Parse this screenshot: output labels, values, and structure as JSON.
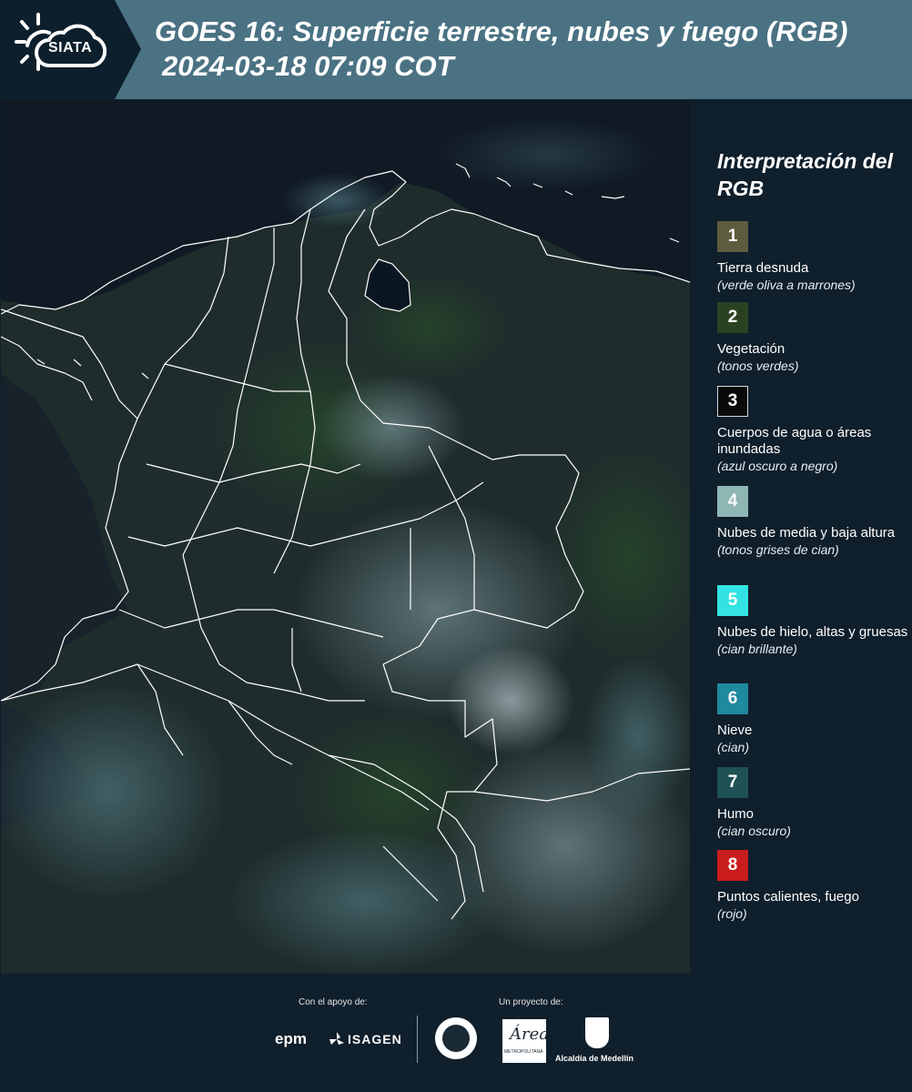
{
  "header": {
    "logo_text": "SIATA",
    "title_line1": "GOES 16: Superficie terrestre, nubes y fuego (RGB)",
    "title_line2": "2024-03-18 07:09 COT"
  },
  "legend": {
    "title": "Interpretación del RGB",
    "items": [
      {
        "num": "1",
        "label": "Tierra desnuda",
        "desc": "(verde oliva a marrones)",
        "color": "#5c5c3f",
        "text_color": "#ffffff"
      },
      {
        "num": "2",
        "label": "Vegetación",
        "desc": "(tonos verdes)",
        "color": "#2b4222",
        "text_color": "#ffffff"
      },
      {
        "num": "3",
        "label": "Cuerpos de agua o áreas inundadas",
        "desc": "(azul oscuro a negro)",
        "color": "#0a0a0a",
        "text_color": "#ffffff"
      },
      {
        "num": "4",
        "label": "Nubes de media y baja altura",
        "desc": "(tonos grises de cian)",
        "color": "#8fb5b5",
        "text_color": "#ffffff"
      },
      {
        "num": "5",
        "label": "Nubes de hielo, altas y gruesas",
        "desc": "(cian brillante)",
        "color": "#33e3e3",
        "text_color": "#ffffff"
      },
      {
        "num": "6",
        "label": "Nieve",
        "desc": "(cian)",
        "color": "#1e8a9e",
        "text_color": "#ffffff"
      },
      {
        "num": "7",
        "label": "Humo",
        "desc": "(cian oscuro)",
        "color": "#1e5254",
        "text_color": "#ffffff"
      },
      {
        "num": "8",
        "label": "Puntos calientes, fuego",
        "desc": "(rojo)",
        "color": "#c91c1c",
        "text_color": "#ffffff"
      }
    ]
  },
  "footer": {
    "support_label": "Con el apoyo de:",
    "project_label": "Un proyecto de:",
    "epm": "epm",
    "isagen": "ISAGEN",
    "alcaldia": "Alcaldía de Medellín",
    "area_script": "Área",
    "area_sub": "METROPOLITANA"
  },
  "colors": {
    "header_bg": "#4a7283",
    "panel_bg": "#0f1f2b",
    "map_ocean": "#0c1620",
    "map_land": "#1d2d24",
    "boundary": "#ffffff"
  }
}
